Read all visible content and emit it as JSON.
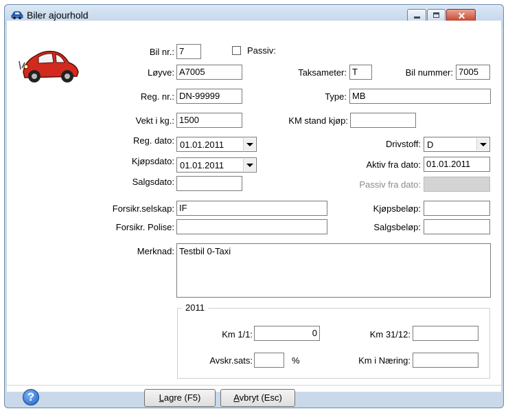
{
  "window": {
    "title": "Biler ajourhold",
    "min_icon": "minimize-icon",
    "max_icon": "maximize-icon",
    "close_icon": "close-icon",
    "close_glyph": "✕"
  },
  "form": {
    "bil_nr": {
      "label": "Bil nr.:",
      "value": "7"
    },
    "passiv": {
      "label": "Passiv:",
      "checked": false
    },
    "loyve": {
      "label": "Løyve:",
      "value": "A7005"
    },
    "taksameter": {
      "label": "Taksameter:",
      "value": "T"
    },
    "bil_nummer": {
      "label": "Bil nummer:",
      "value": "7005"
    },
    "reg_nr": {
      "label": "Reg. nr.:",
      "value": "DN-99999"
    },
    "type": {
      "label": "Type:",
      "value": "MB"
    },
    "vekt": {
      "label": "Vekt i kg.:",
      "value": "1500"
    },
    "km_stand_kjop": {
      "label": "KM stand kjøp:",
      "value": ""
    },
    "reg_dato": {
      "label": "Reg. dato:",
      "value": "01.01.2011"
    },
    "drivstoff": {
      "label": "Drivstoff:",
      "value": "D"
    },
    "kjopsdato": {
      "label": "Kjøpsdato:",
      "value": "01.01.2011"
    },
    "aktiv_fra_dato": {
      "label": "Aktiv fra dato:",
      "value": "01.01.2011"
    },
    "salgsdato": {
      "label": "Salgsdato:",
      "value": ""
    },
    "passiv_fra_dato": {
      "label": "Passiv fra dato:",
      "value": ""
    },
    "forsikr_selskap": {
      "label": "Forsikr.selskap:",
      "value": "IF"
    },
    "kjopsbelop": {
      "label": "Kjøpsbeløp:",
      "value": ""
    },
    "forsikr_polise": {
      "label": "Forsikr. Polise:",
      "value": ""
    },
    "salgsbelop": {
      "label": "Salgsbeløp:",
      "value": ""
    },
    "merknad": {
      "label": "Merknad:",
      "value": "Testbil 0-Taxi"
    }
  },
  "year_group": {
    "title": "2011",
    "km_1_1": {
      "label": "Km 1/1:",
      "value": "0"
    },
    "km_31_12": {
      "label": "Km 31/12:",
      "value": ""
    },
    "avskr_sats": {
      "label": "Avskr.sats:",
      "value": "",
      "unit": "%"
    },
    "km_i_naering": {
      "label": "Km i Næring:",
      "value": ""
    }
  },
  "buttons": {
    "lagre": {
      "accel": "L",
      "rest": "agre (F5)"
    },
    "avbryt": {
      "accel": "A",
      "rest": "vbryt (Esc)"
    },
    "help_glyph": "?"
  },
  "colors": {
    "titlebar": "#c9d9ea",
    "close_button": "#c2452c",
    "car_red": "#d22a1e",
    "help_blue": "#1b5fc4"
  }
}
